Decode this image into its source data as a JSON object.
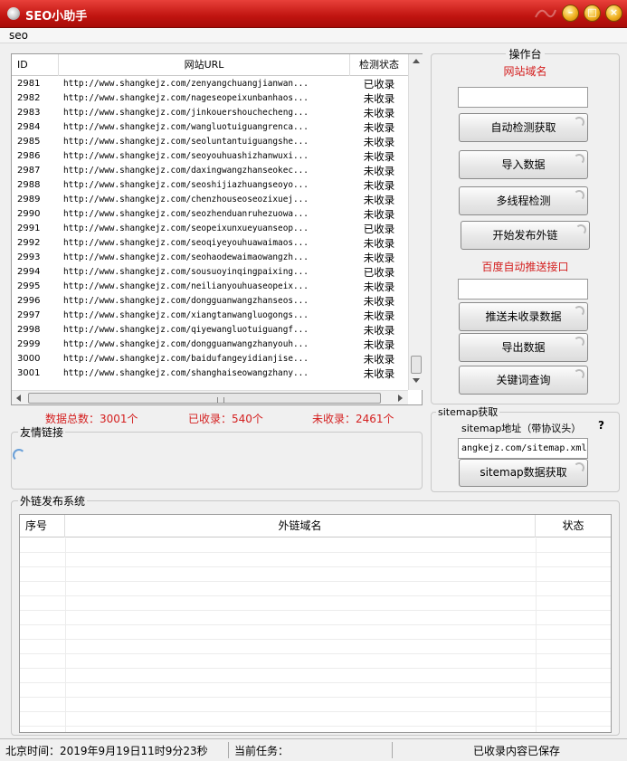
{
  "window": {
    "title": "SEO小助手",
    "minimize": "–",
    "maximize": "□",
    "close": "×"
  },
  "menu": {
    "seo": "seo"
  },
  "table": {
    "headers": {
      "id": "ID",
      "url": "网站URL",
      "status": "检测状态"
    },
    "rows": [
      {
        "id": "2981",
        "url": "http://www.shangkejz.com/zenyangchuangjianwan...",
        "status": "已收录"
      },
      {
        "id": "2982",
        "url": "http://www.shangkejz.com/nageseopeixunbanhaos...",
        "status": "未收录"
      },
      {
        "id": "2983",
        "url": "http://www.shangkejz.com/jinkouershouchecheng...",
        "status": "未收录"
      },
      {
        "id": "2984",
        "url": "http://www.shangkejz.com/wangluotuiguangrenca...",
        "status": "未收录"
      },
      {
        "id": "2985",
        "url": "http://www.shangkejz.com/seoluntantuiguangshe...",
        "status": "未收录"
      },
      {
        "id": "2986",
        "url": "http://www.shangkejz.com/seoyouhuashizhanwuxi...",
        "status": "未收录"
      },
      {
        "id": "2987",
        "url": "http://www.shangkejz.com/daxingwangzhanseokec...",
        "status": "未收录"
      },
      {
        "id": "2988",
        "url": "http://www.shangkejz.com/seoshijiazhuangseoyo...",
        "status": "未收录"
      },
      {
        "id": "2989",
        "url": "http://www.shangkejz.com/chenzhouseoseozixuej...",
        "status": "未收录"
      },
      {
        "id": "2990",
        "url": "http://www.shangkejz.com/seozhenduanruhezuowa...",
        "status": "未收录"
      },
      {
        "id": "2991",
        "url": "http://www.shangkejz.com/seopeixunxueyuanseop...",
        "status": "已收录"
      },
      {
        "id": "2992",
        "url": "http://www.shangkejz.com/seoqiyeyouhuawaimaos...",
        "status": "未收录"
      },
      {
        "id": "2993",
        "url": "http://www.shangkejz.com/seohaodewaimaowangzh...",
        "status": "未收录"
      },
      {
        "id": "2994",
        "url": "http://www.shangkejz.com/sousuoyinqingpaixing...",
        "status": "已收录"
      },
      {
        "id": "2995",
        "url": "http://www.shangkejz.com/neilianyouhuaseopeix...",
        "status": "未收录"
      },
      {
        "id": "2996",
        "url": "http://www.shangkejz.com/dongguanwangzhanseos...",
        "status": "未收录"
      },
      {
        "id": "2997",
        "url": "http://www.shangkejz.com/xiangtanwangluogongs...",
        "status": "未收录"
      },
      {
        "id": "2998",
        "url": "http://www.shangkejz.com/qiyewangluotuiguangf...",
        "status": "未收录"
      },
      {
        "id": "2999",
        "url": "http://www.shangkejz.com/dongguanwangzhanyouh...",
        "status": "未收录"
      },
      {
        "id": "3000",
        "url": "http://www.shangkejz.com/baidufangeyidianjise...",
        "status": "未收录"
      },
      {
        "id": "3001",
        "url": "http://www.shangkejz.com/shanghaiseowangzhany...",
        "status": "未收录"
      }
    ]
  },
  "stats": {
    "total": "数据总数：3001个",
    "indexed": "已收录：540个",
    "not_indexed": "未收录：2461个"
  },
  "friends": {
    "label": "友情链接"
  },
  "console": {
    "title": "操作台",
    "domain_label": "网站域名",
    "domain_value": "",
    "btn_auto_detect": "自动检测获取",
    "btn_import": "导入数据",
    "btn_multithread": "多线程检测",
    "btn_publish": "开始发布外链",
    "baidu_label": "百度自动推送接口",
    "baidu_value": "",
    "btn_push": "推送未收录数据",
    "btn_export": "导出数据",
    "btn_keyword": "关键词查询"
  },
  "sitemap": {
    "label": "sitemap获取",
    "addr_label": "sitemap地址（带协议头）",
    "help": "?",
    "addr_value": "angkejz.com/sitemap.xml",
    "btn_fetch": "sitemap数据获取"
  },
  "publish": {
    "label": "外链发布系统",
    "headers": {
      "no": "序号",
      "domain": "外链域名",
      "state": "状态"
    }
  },
  "statusbar": {
    "time": "北京时间：2019年9月19日11时9分23秒",
    "task": "当前任务：",
    "saved": "已收录内容已保存"
  }
}
